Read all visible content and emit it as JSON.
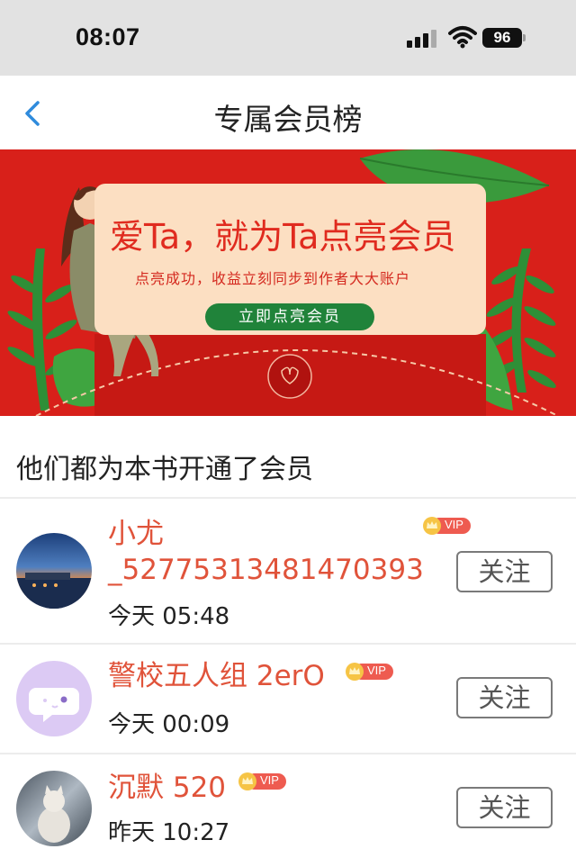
{
  "status": {
    "time": "08:07",
    "battery": "96"
  },
  "nav": {
    "title": "专属会员榜"
  },
  "banner": {
    "headline": "爱Ta，就为Ta点亮会员",
    "subtitle": "点亮成功，收益立刻同步到作者大大账户",
    "button": "立即点亮会员"
  },
  "section": {
    "title": "他们都为本书开通了会员"
  },
  "members": [
    {
      "name_line1": "小尤",
      "name_line2": "_52775313481470393",
      "time": "今天 05:48",
      "badge": "VIP",
      "follow": "关注"
    },
    {
      "name": "警校五人组 2erO",
      "time": "今天 00:09",
      "badge": "VIP",
      "follow": "关注"
    },
    {
      "name": "沉默 520",
      "time": "昨天 10:27",
      "badge": "VIP",
      "follow": "关注"
    }
  ],
  "colors": {
    "accent": "#e0533a",
    "banner_red": "#d8201a",
    "banner_green": "#20833a",
    "back_arrow": "#2f8bdc"
  }
}
